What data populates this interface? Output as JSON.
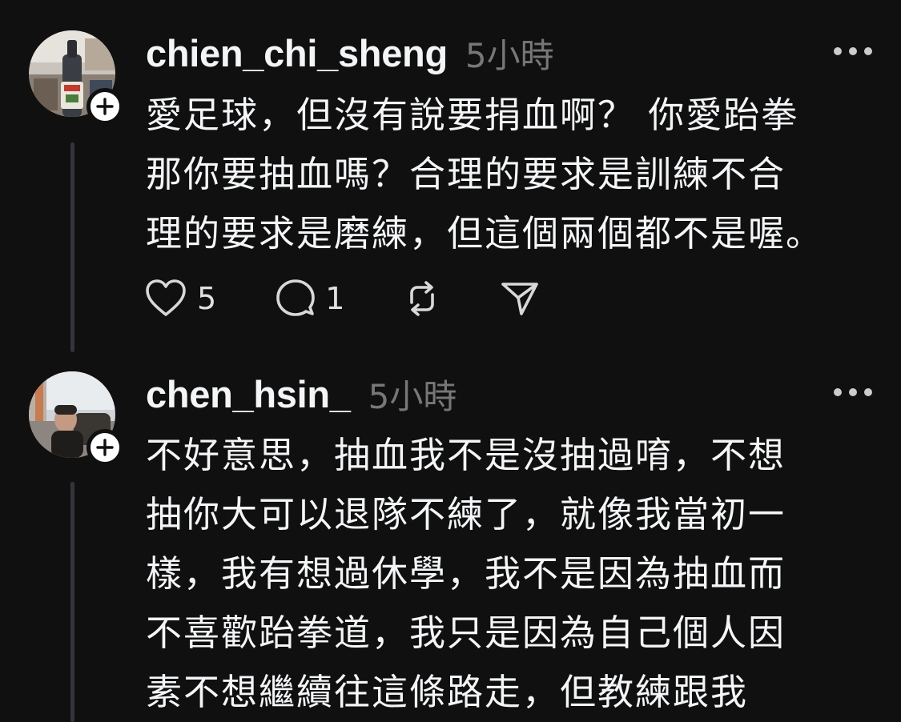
{
  "posts": [
    {
      "username": "chien_chi_sheng",
      "time": "5小時",
      "body": "愛足球，但沒有說要捐血啊？ 你愛跆拳\n那你要抽血嗎？合理的要求是訓練不合\n理的要求是磨練，但這個兩個都不是喔。",
      "likes": "5",
      "replies": "1"
    },
    {
      "username": "chen_hsin_",
      "time": "5小時",
      "body": "不好意思，抽血我不是沒抽過唷，不想\n抽你大可以退隊不練了，就像我當初一\n樣，我有想過休學，我不是因為抽血而\n不喜歡跆拳道，我只是因為自己個人因\n素不想繼續往這條路走，但教練跟我"
    }
  ],
  "colors": {
    "background": "#101010",
    "text": "#f3f5f7",
    "muted": "#777777",
    "thread_line": "#333638"
  },
  "icons": {
    "like": "heart-icon",
    "reply": "comment-icon",
    "repost": "repost-icon",
    "share": "send-icon",
    "more": "more-horizontal-icon",
    "follow": "plus-icon"
  }
}
